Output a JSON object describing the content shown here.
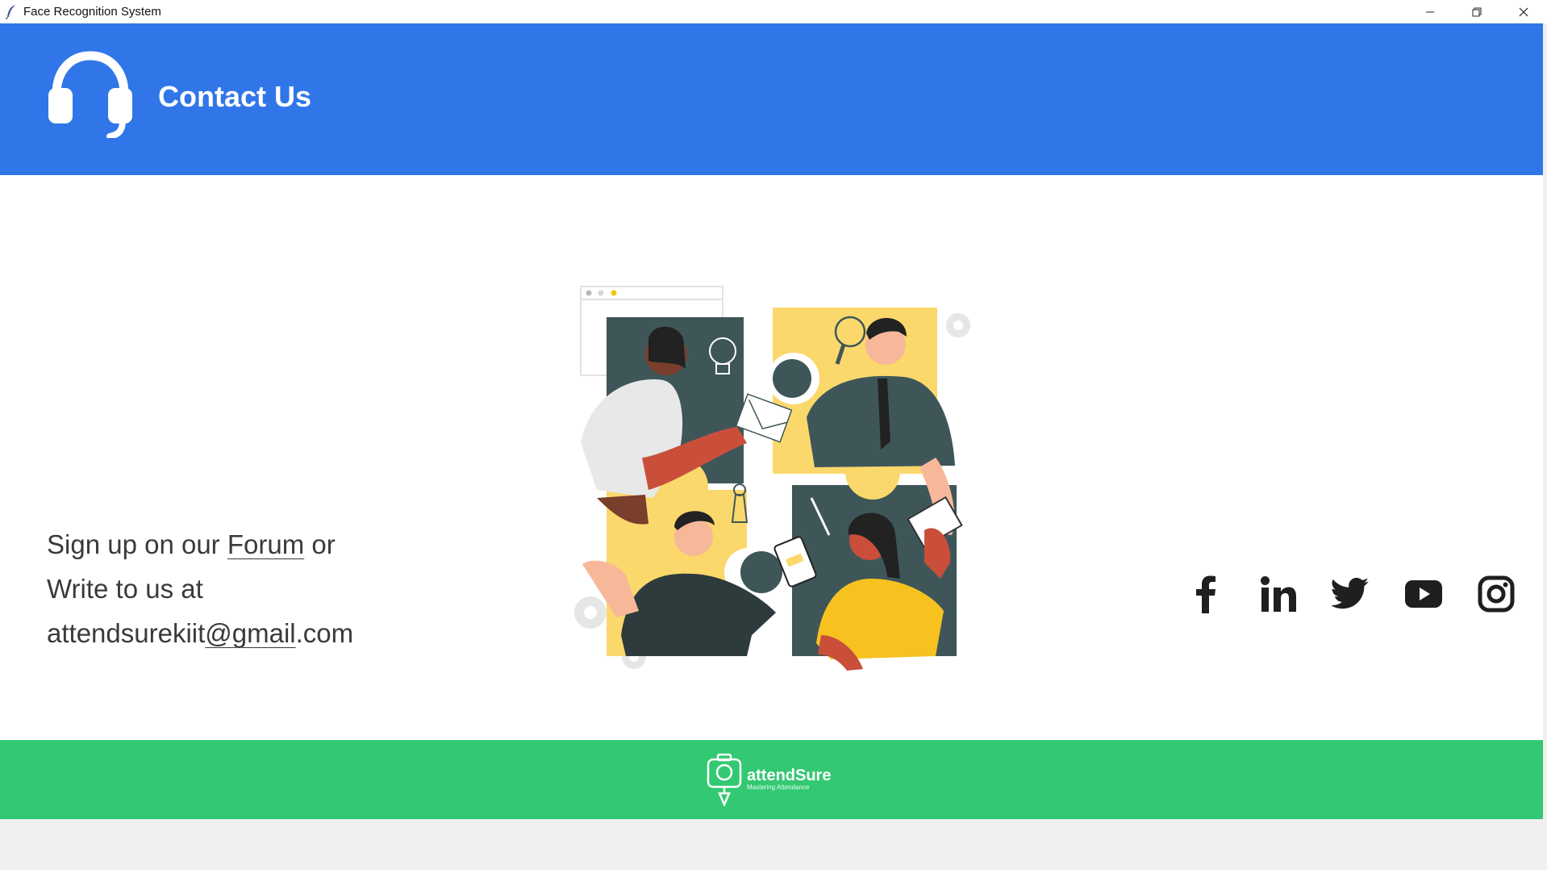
{
  "window": {
    "title": "Face Recognition System",
    "controls": [
      "minimize-icon",
      "restore-icon",
      "close-icon"
    ]
  },
  "header": {
    "icon": "headset-icon",
    "title": "Contact Us",
    "background": "#3076e8"
  },
  "contact": {
    "line1_prefix": "Sign up on our ",
    "forum_link": "Forum",
    "line1_suffix": " or",
    "line2": "Write to us at",
    "email_user": "attendsurekiit",
    "email_domain": "@gmail",
    "email_tld": ".com"
  },
  "illustration": {
    "icon": "team-collaboration-illustration"
  },
  "socials": [
    {
      "icon": "facebook-icon"
    },
    {
      "icon": "linkedin-icon"
    },
    {
      "icon": "twitter-icon"
    },
    {
      "icon": "youtube-icon"
    },
    {
      "icon": "instagram-icon"
    }
  ],
  "footer": {
    "brand": "attendSure",
    "tagline": "Mastering Attendance",
    "background": "#33c872"
  }
}
